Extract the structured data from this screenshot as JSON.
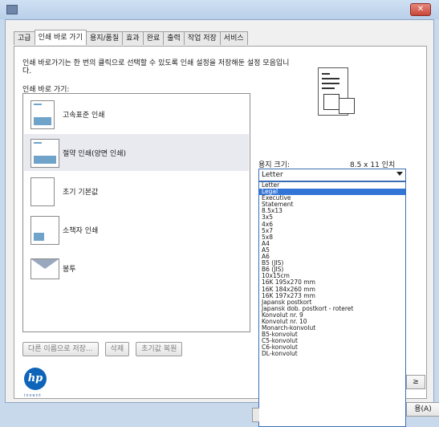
{
  "window": {
    "close_glyph": "✕"
  },
  "tabs": [
    "고급",
    "인쇄 바로 가기",
    "용지/품질",
    "효과",
    "완료",
    "출력",
    "작업 저장",
    "서비스"
  ],
  "active_tab": 1,
  "description": "인쇄 바로가기는 한 번의 클릭으로 선택할 수 있도록 인쇄 설정을 저장해둔 설정 모음입니다.",
  "list_label": "인쇄 바로 가기:",
  "shortcuts": [
    {
      "label": "고속표준 인쇄",
      "icon": "landscape-doc-icon"
    },
    {
      "label": "절약 인쇄(양면 인쇄)",
      "icon": "duplex-doc-icon",
      "selected": true
    },
    {
      "label": "초기 기본값",
      "icon": "blank-doc-icon"
    },
    {
      "label": "소책자 인쇄",
      "icon": "booklet-icon"
    },
    {
      "label": "봉투",
      "icon": "envelope-icon"
    }
  ],
  "buttons": {
    "save_as": "다른 이름으로 저장...",
    "delete": "삭제",
    "reset": "초기값 복원"
  },
  "paper_size": {
    "label": "용지 크기:",
    "value": "8.5 x 11 인치",
    "selected": "Letter"
  },
  "paper_options": [
    "Letter",
    "Legal",
    "Executive",
    "Statement",
    "8.5x13",
    "3x5",
    "4x6",
    "5x7",
    "5x8",
    "A4",
    "A5",
    "A6",
    "B5 (JIS)",
    "B6 (JIS)",
    "10x15cm",
    "16K 195x270 mm",
    "16K 184x260 mm",
    "16K 197x273 mm",
    "Japansk postkort",
    "Japansk dob. postkort - roteret",
    "Konvolut nr. 9",
    "Konvolut nr. 10",
    "Monarch-konvolut",
    "B5-konvolut",
    "C5-konvolut",
    "C6-konvolut",
    "DL-konvolut"
  ],
  "highlighted_option": 1,
  "logo": {
    "text": "hp",
    "tagline": "invent"
  },
  "right_buttons": {
    "b1": "≥",
    "b2": "용(A)"
  },
  "colors": {
    "highlight": "#3375d6",
    "frame": "#c9d9ec",
    "hp_blue": "#0e64b8"
  }
}
